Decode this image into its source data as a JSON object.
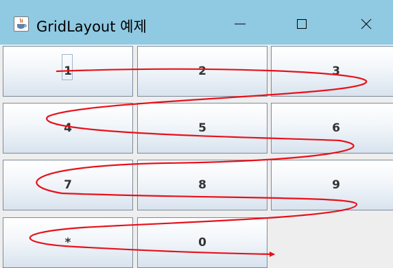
{
  "window": {
    "title": "GridLayout 예제",
    "icon": "java-cup-icon",
    "controls": [
      "minimize-icon",
      "maximize-icon",
      "close-icon"
    ]
  },
  "keypad": {
    "keys": [
      "1",
      "2",
      "3",
      "4",
      "5",
      "6",
      "7",
      "8",
      "9",
      "*",
      "0"
    ],
    "focused": "1"
  },
  "colors": {
    "titlebar": "#8fc9e2",
    "background": "#eeeeee",
    "annotation": "#e8101a"
  }
}
